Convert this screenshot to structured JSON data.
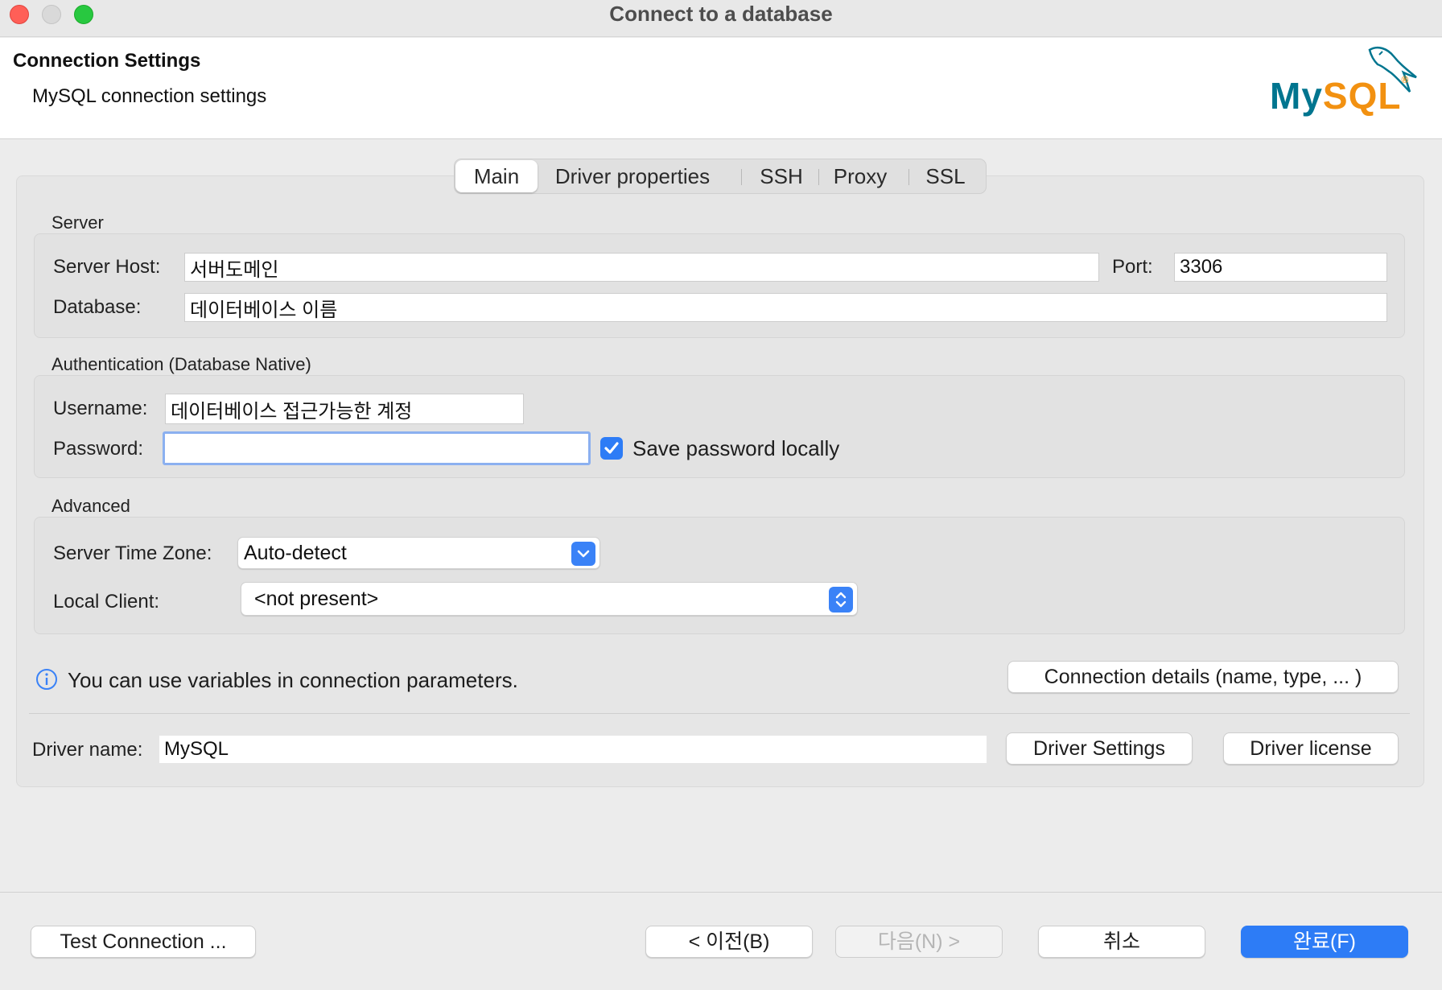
{
  "window": {
    "title": "Connect to a database"
  },
  "header": {
    "title": "Connection Settings",
    "subtitle": "MySQL connection settings",
    "logo_text": "MySQL",
    "logo_color_blue": "#00758f",
    "logo_color_orange": "#f29111"
  },
  "tabs": [
    {
      "label": "Main",
      "active": true
    },
    {
      "label": "Driver properties",
      "active": false
    },
    {
      "label": "SSH",
      "active": false
    },
    {
      "label": "Proxy",
      "active": false
    },
    {
      "label": "SSL",
      "active": false
    }
  ],
  "server": {
    "group_label": "Server",
    "host_label": "Server Host:",
    "host_value": "서버도메인",
    "port_label": "Port:",
    "port_value": "3306",
    "database_label": "Database:",
    "database_value": "데이터베이스 이름"
  },
  "auth": {
    "group_label": "Authentication (Database Native)",
    "username_label": "Username:",
    "username_value": "데이터베이스 접근가능한 계정",
    "password_label": "Password:",
    "password_value": "",
    "save_password_label": "Save password locally",
    "save_password_checked": true
  },
  "advanced": {
    "group_label": "Advanced",
    "timezone_label": "Server Time Zone:",
    "timezone_value": "Auto-detect",
    "local_client_label": "Local Client:",
    "local_client_value": "<not present>"
  },
  "info": {
    "text": "You can use variables in connection parameters.",
    "connection_details_button": "Connection details (name, type, ... )"
  },
  "driver": {
    "name_label": "Driver name:",
    "name_value": "MySQL",
    "settings_button": "Driver Settings",
    "license_button": "Driver license"
  },
  "footer": {
    "test_connection": "Test Connection ...",
    "back": "< 이전(B)",
    "next": "다음(N) >",
    "cancel": "취소",
    "finish": "완료(F)"
  },
  "colors": {
    "accent": "#2d7cf6",
    "close": "#ff5f57",
    "minimize": "#d9d9d9",
    "zoom": "#28c840"
  }
}
